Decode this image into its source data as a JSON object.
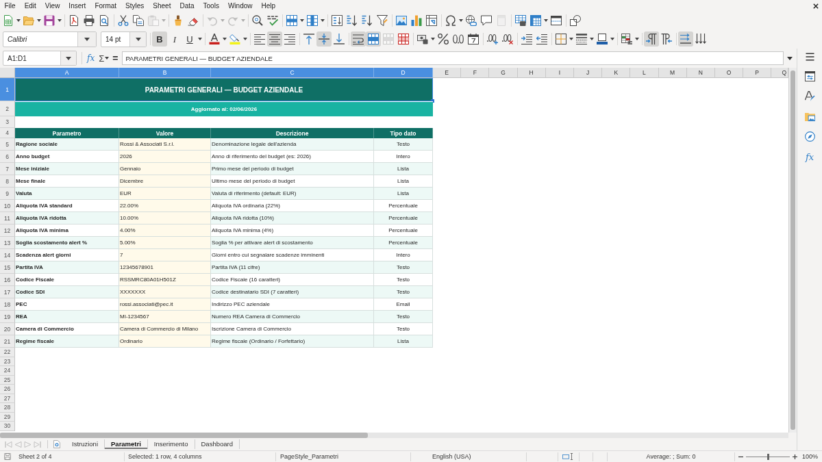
{
  "menu_bar": [
    "File",
    "Edit",
    "View",
    "Insert",
    "Format",
    "Styles",
    "Sheet",
    "Data",
    "Tools",
    "Window",
    "Help"
  ],
  "standard_toolbar": [
    [
      {
        "kind": "new",
        "disabled": false,
        "dropdown": true
      },
      {
        "kind": "open",
        "disabled": false,
        "dropdown": true
      },
      {
        "kind": "save",
        "disabled": false,
        "dropdown": true
      }
    ],
    [
      {
        "kind": "pdf",
        "disabled": false,
        "dropdown": false
      },
      {
        "kind": "print",
        "disabled": false,
        "dropdown": false
      },
      {
        "kind": "preview",
        "disabled": false,
        "dropdown": false
      }
    ],
    [
      {
        "kind": "cut",
        "disabled": false,
        "dropdown": false
      },
      {
        "kind": "copy",
        "disabled": false,
        "dropdown": false
      },
      {
        "kind": "paste",
        "disabled": true,
        "dropdown": true
      }
    ],
    [
      {
        "kind": "clone",
        "disabled": false,
        "dropdown": false
      },
      {
        "kind": "clear",
        "disabled": false,
        "dropdown": false
      }
    ],
    [
      {
        "kind": "undo",
        "disabled": true,
        "dropdown": true
      },
      {
        "kind": "redo",
        "disabled": true,
        "dropdown": true
      }
    ],
    [
      {
        "kind": "find",
        "disabled": false,
        "dropdown": false
      },
      {
        "kind": "spelling",
        "disabled": false,
        "dropdown": false
      }
    ],
    [
      {
        "kind": "rows",
        "disabled": false,
        "dropdown": true
      },
      {
        "kind": "columns",
        "disabled": false,
        "dropdown": true
      }
    ],
    [
      {
        "kind": "sort",
        "disabled": false,
        "dropdown": false
      },
      {
        "kind": "ascending",
        "disabled": false,
        "dropdown": false
      },
      {
        "kind": "descending",
        "disabled": false,
        "dropdown": false
      },
      {
        "kind": "filter",
        "disabled": false,
        "dropdown": false
      }
    ],
    [
      {
        "kind": "image",
        "disabled": false,
        "dropdown": false
      },
      {
        "kind": "chart",
        "disabled": false,
        "dropdown": false
      },
      {
        "kind": "pivot",
        "disabled": false,
        "dropdown": false
      }
    ],
    [
      {
        "kind": "special",
        "disabled": false,
        "dropdown": true
      },
      {
        "kind": "hyperlink",
        "disabled": false,
        "dropdown": false
      },
      {
        "kind": "comment",
        "disabled": false,
        "dropdown": false
      },
      {
        "kind": "headerfooter",
        "disabled": true,
        "dropdown": false
      }
    ],
    [
      {
        "kind": "printrange",
        "disabled": false,
        "dropdown": false
      },
      {
        "kind": "freeze",
        "disabled": false,
        "dropdown": true
      },
      {
        "kind": "split",
        "disabled": false,
        "dropdown": false
      }
    ],
    [
      {
        "kind": "shapes",
        "disabled": false,
        "dropdown": false
      }
    ]
  ],
  "formatting_toolbar": {
    "font_name": "Calibri",
    "font_size": "14 pt",
    "groups": [
      [
        {
          "kind": "bold",
          "label": "B",
          "on": true,
          "disabled": false,
          "dropdown": false
        },
        {
          "kind": "italic",
          "label": "I",
          "on": false,
          "disabled": false,
          "dropdown": false
        },
        {
          "kind": "underline",
          "label": "U",
          "on": false,
          "disabled": false,
          "dropdown": true
        }
      ],
      [
        {
          "kind": "fontcolor",
          "on": false,
          "disabled": false,
          "dropdown": true
        },
        {
          "kind": "highlight",
          "on": false,
          "disabled": false,
          "dropdown": true
        }
      ],
      [
        {
          "kind": "alignleft",
          "on": false,
          "disabled": false,
          "dropdown": false
        },
        {
          "kind": "aligncenter",
          "on": true,
          "disabled": false,
          "dropdown": false
        },
        {
          "kind": "alignright",
          "on": false,
          "disabled": false,
          "dropdown": false
        }
      ],
      [
        {
          "kind": "aligntop",
          "on": false,
          "disabled": false,
          "dropdown": false
        },
        {
          "kind": "alignmiddle",
          "on": true,
          "disabled": false,
          "dropdown": false
        },
        {
          "kind": "alignbottom",
          "on": false,
          "disabled": false,
          "dropdown": false
        }
      ],
      [
        {
          "kind": "wrap",
          "on": true,
          "disabled": false,
          "dropdown": false
        },
        {
          "kind": "mergecenter",
          "on": true,
          "disabled": false,
          "dropdown": false
        },
        {
          "kind": "merge",
          "on": false,
          "disabled": true,
          "dropdown": false
        },
        {
          "kind": "unmerge",
          "on": false,
          "disabled": false,
          "dropdown": false
        }
      ],
      [
        {
          "kind": "currency",
          "on": false,
          "disabled": false,
          "dropdown": true
        },
        {
          "kind": "percent",
          "on": false,
          "disabled": false,
          "dropdown": false
        },
        {
          "kind": "number",
          "on": false,
          "disabled": false,
          "dropdown": false
        },
        {
          "kind": "date",
          "on": false,
          "disabled": false,
          "dropdown": false
        }
      ],
      [
        {
          "kind": "adddecimal",
          "on": false,
          "disabled": false,
          "dropdown": false
        },
        {
          "kind": "deldecimal",
          "on": false,
          "disabled": false,
          "dropdown": false
        }
      ],
      [
        {
          "kind": "indent",
          "on": false,
          "disabled": false,
          "dropdown": false
        },
        {
          "kind": "outdent",
          "on": false,
          "disabled": false,
          "dropdown": false
        }
      ],
      [
        {
          "kind": "borders",
          "on": false,
          "disabled": false,
          "dropdown": true
        },
        {
          "kind": "borderstyle",
          "on": false,
          "disabled": false,
          "dropdown": true
        },
        {
          "kind": "bordercolor",
          "on": false,
          "disabled": false,
          "dropdown": true
        }
      ],
      [
        {
          "kind": "conditional",
          "on": false,
          "disabled": false,
          "dropdown": true
        }
      ],
      [
        {
          "kind": "ltr",
          "on": true,
          "disabled": false,
          "dropdown": false
        },
        {
          "kind": "rtl",
          "on": false,
          "disabled": false,
          "dropdown": false
        }
      ],
      [
        {
          "kind": "textltr",
          "on": true,
          "disabled": false,
          "dropdown": false
        },
        {
          "kind": "textttb",
          "on": false,
          "disabled": false,
          "dropdown": false
        }
      ]
    ]
  },
  "formula_bar": {
    "name_box": "A1:D1",
    "function_wizard": "fx",
    "sum": "Σ",
    "equals": "=",
    "content": "PARAMETRI GENERALI — BUDGET AZIENDALE"
  },
  "sheet": {
    "columns": [
      {
        "label": "A",
        "selected": true
      },
      {
        "label": "B",
        "selected": true
      },
      {
        "label": "C",
        "selected": true
      },
      {
        "label": "D",
        "selected": true
      },
      {
        "label": "E",
        "selected": false
      },
      {
        "label": "F",
        "selected": false
      },
      {
        "label": "G",
        "selected": false
      },
      {
        "label": "H",
        "selected": false
      },
      {
        "label": "I",
        "selected": false
      },
      {
        "label": "J",
        "selected": false
      },
      {
        "label": "K",
        "selected": false
      },
      {
        "label": "L",
        "selected": false
      },
      {
        "label": "M",
        "selected": false
      },
      {
        "label": "N",
        "selected": false
      },
      {
        "label": "O",
        "selected": false
      },
      {
        "label": "P",
        "selected": false
      },
      {
        "label": "Q",
        "selected": false
      }
    ],
    "rows": [
      {
        "label": "1",
        "selected": true
      },
      {
        "label": "2",
        "selected": false
      },
      {
        "label": "3",
        "selected": false
      },
      {
        "label": "4",
        "selected": false
      },
      {
        "label": "5",
        "selected": false
      },
      {
        "label": "6",
        "selected": false
      },
      {
        "label": "7",
        "selected": false
      },
      {
        "label": "8",
        "selected": false
      },
      {
        "label": "9",
        "selected": false
      },
      {
        "label": "10",
        "selected": false
      },
      {
        "label": "11",
        "selected": false
      },
      {
        "label": "12",
        "selected": false
      },
      {
        "label": "13",
        "selected": false
      },
      {
        "label": "14",
        "selected": false
      },
      {
        "label": "15",
        "selected": false
      },
      {
        "label": "16",
        "selected": false
      },
      {
        "label": "17",
        "selected": false
      },
      {
        "label": "18",
        "selected": false
      },
      {
        "label": "19",
        "selected": false
      },
      {
        "label": "20",
        "selected": false
      },
      {
        "label": "21",
        "selected": false
      },
      {
        "label": "22",
        "selected": false
      },
      {
        "label": "23",
        "selected": false
      },
      {
        "label": "24",
        "selected": false
      },
      {
        "label": "25",
        "selected": false
      },
      {
        "label": "26",
        "selected": false
      },
      {
        "label": "27",
        "selected": false
      },
      {
        "label": "28",
        "selected": false
      },
      {
        "label": "29",
        "selected": false
      },
      {
        "label": "30",
        "selected": false
      }
    ],
    "title": {
      "text": "PARAMETRI GENERALI — BUDGET AZIENDALE",
      "selected": true
    },
    "subtitle": "Aggiornato al: 02/06/2026",
    "table": {
      "columns": [
        "Parametro",
        "Valore",
        "Descrizione",
        "Tipo dato"
      ],
      "rows": [
        [
          "Ragione sociale",
          "Rossi & Associati S.r.l.",
          "Denominazione legale dell'azienda",
          "Testo"
        ],
        [
          "Anno budget",
          "2026",
          "Anno di riferimento del budget (es: 2026)",
          "Intero"
        ],
        [
          "Mese iniziale",
          "Gennaio",
          "Primo mese del periodo di budget",
          "Lista"
        ],
        [
          "Mese finale",
          "Dicembre",
          "Ultimo mese del periodo di budget",
          "Lista"
        ],
        [
          "Valuta",
          "EUR",
          "Valuta di riferimento (default: EUR)",
          "Lista"
        ],
        [
          "Aliquota IVA standard",
          "22.00%",
          "Aliquota IVA ordinaria (22%)",
          "Percentuale"
        ],
        [
          "Aliquota IVA ridotta",
          "10.00%",
          "Aliquota IVA ridotta (10%)",
          "Percentuale"
        ],
        [
          "Aliquota IVA minima",
          "4.00%",
          "Aliquota IVA minima (4%)",
          "Percentuale"
        ],
        [
          "Soglia scostamento alert %",
          "5.00%",
          "Soglia % per attivare alert di scostamento",
          "Percentuale"
        ],
        [
          "Scadenza alert giorni",
          "7",
          "Giorni entro cui segnalare scadenze imminenti",
          "Intero"
        ],
        [
          "Partita IVA",
          "12345678901",
          "Partita IVA (11 cifre)",
          "Testo"
        ],
        [
          "Codice Fiscale",
          "RSSMRC80A01H501Z",
          "Codice Fiscale (16 caratteri)",
          "Testo"
        ],
        [
          "Codice SDI",
          "XXXXXXX",
          "Codice destinatario SDI (7 caratteri)",
          "Testo"
        ],
        [
          "PEC",
          "rossi.associati@pec.it",
          "Indirizzo PEC aziendale",
          "Email"
        ],
        [
          "REA",
          "MI-1234567",
          "Numero REA Camera di Commercio",
          "Testo"
        ],
        [
          "Camera di Commercio",
          "Camera di Commercio di Milano",
          "Iscrizione Camera di Commercio",
          "Testo"
        ],
        [
          "Regime fiscale",
          "Ordinario",
          "Regime fiscale (Ordinario / Forfettario)",
          "Lista"
        ]
      ]
    }
  },
  "sheet_tabs": [
    {
      "label": "Istruzioni",
      "selected": false
    },
    {
      "label": "Parametri",
      "selected": true
    },
    {
      "label": "Inserimento",
      "selected": false
    },
    {
      "label": "Dashboard",
      "selected": false
    }
  ],
  "sidebar": {
    "functions": "fx"
  },
  "status_bar": {
    "sheet": "Sheet 2 of 4",
    "selection": "Selected: 1 row, 4 columns",
    "page_style": "PageStyle_Parametri",
    "language": "English (USA)",
    "summary": "Average: ; Sum: 0",
    "zoom": {
      "level": 0.5,
      "reading": "100%"
    }
  }
}
